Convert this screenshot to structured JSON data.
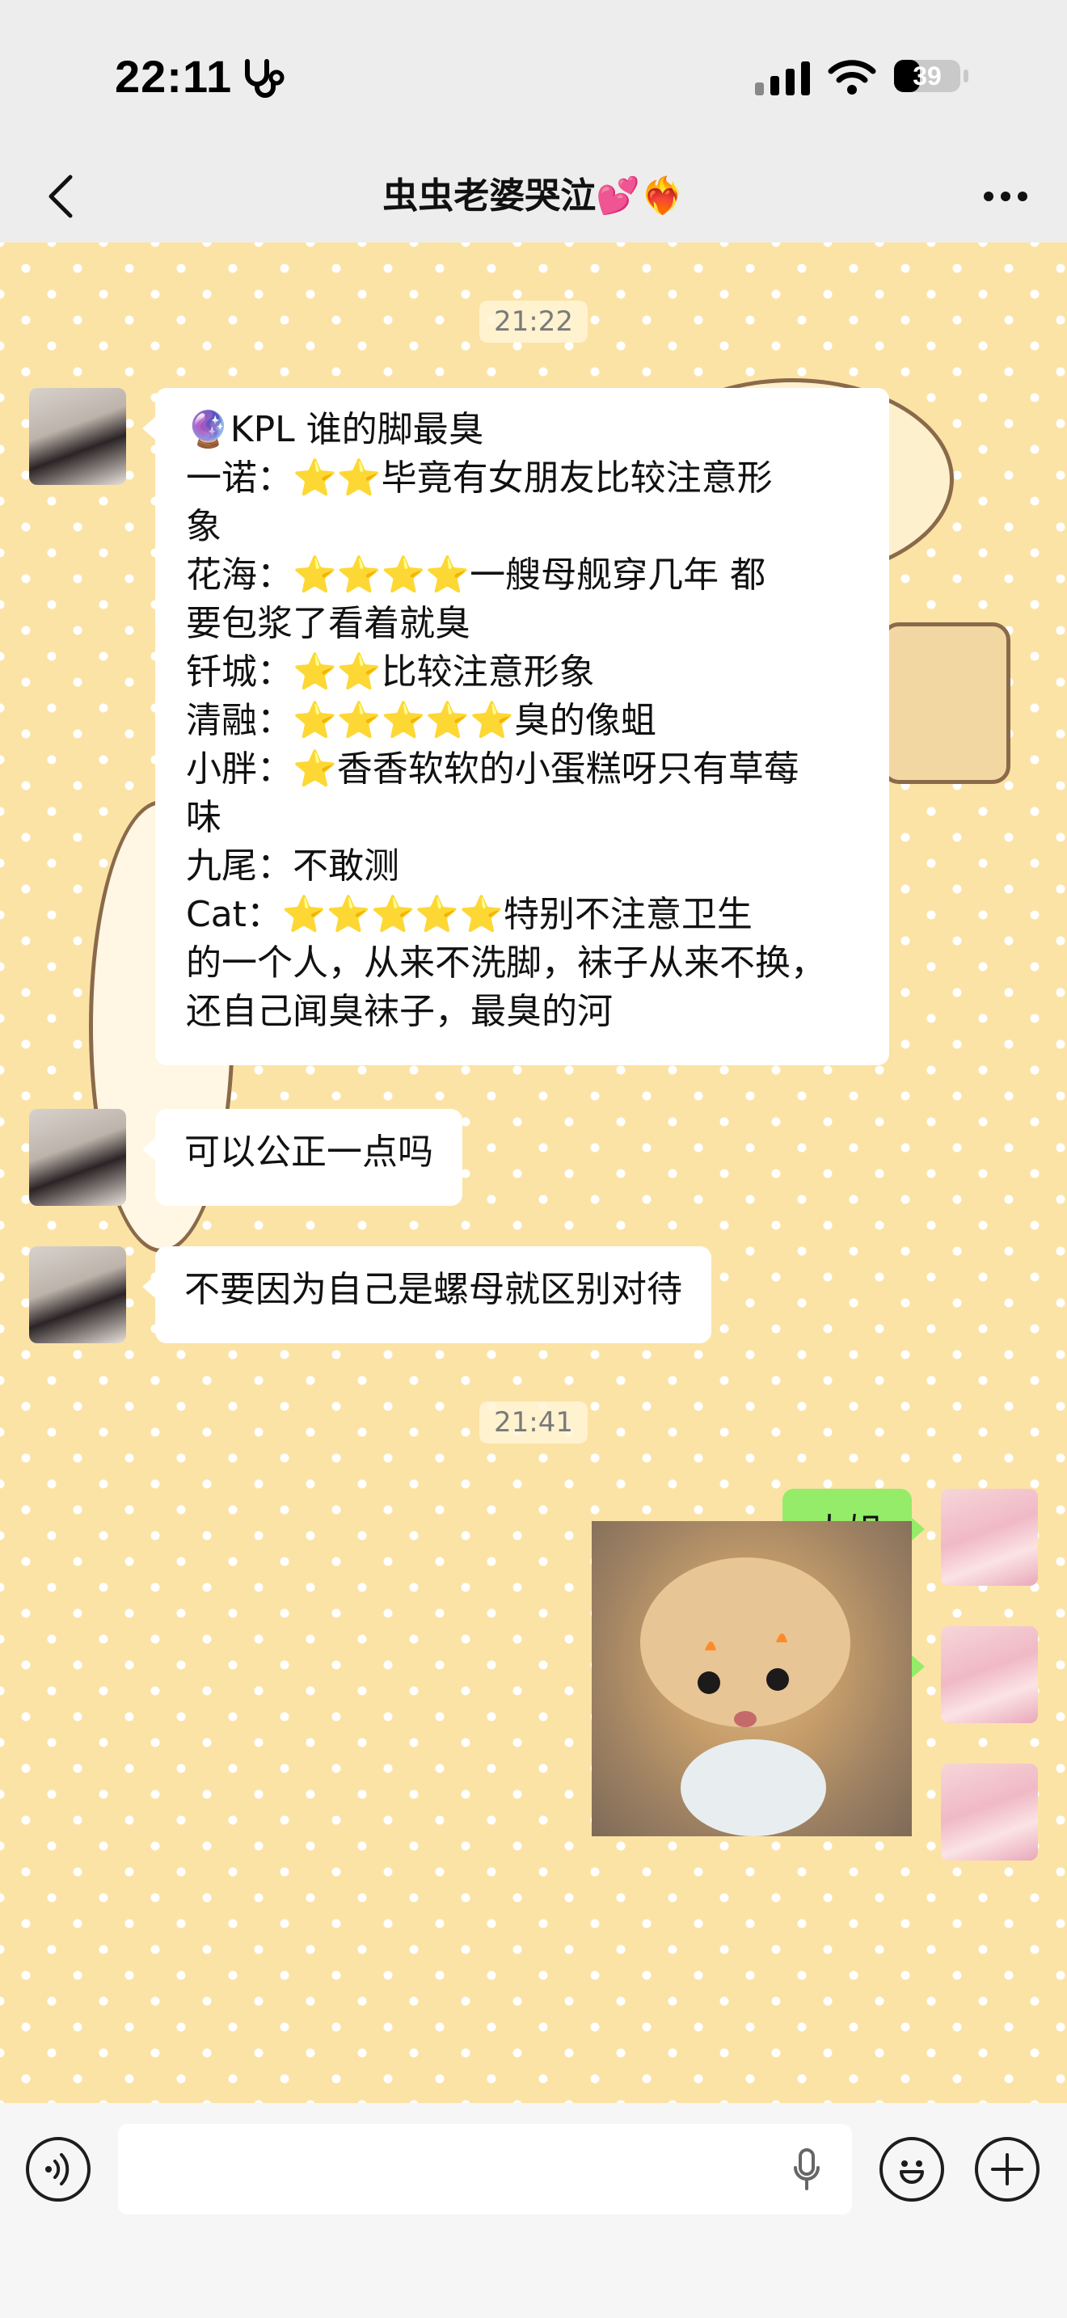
{
  "status_bar": {
    "time": "22:11",
    "battery": "39"
  },
  "header": {
    "title": "虫虫老婆哭泣💕❤️‍🔥"
  },
  "messages": {
    "time_1": "21:22",
    "msg1_lines": [
      "🔮KPL 谁的脚最臭",
      "一诺：⭐⭐毕竟有女朋友比较注意形",
      "象",
      "花海：⭐⭐⭐⭐一艘母舰穿几年 都",
      "要包浆了看着就臭",
      "钎城：⭐⭐比较注意形象",
      "清融：⭐⭐⭐⭐⭐臭的像蛆",
      "小胖：⭐香香软软的小蛋糕呀只有草莓",
      "味",
      "九尾：不敢测",
      "Cat：⭐⭐⭐⭐⭐特别不注意卫生",
      "的一个人，从来不洗脚，袜子从来不换，",
      "还自己闻臭袜子，最臭的河"
    ],
    "msg2": "可以公正一点吗",
    "msg3": "不要因为自己是螺母就区别对待",
    "time_2": "21:41",
    "msg4": "大姐",
    "msg5": "🙂"
  },
  "colors": {
    "chat_bg": "#fbe3a6",
    "own_bubble": "#95ec69",
    "other_bubble": "#ffffff"
  }
}
